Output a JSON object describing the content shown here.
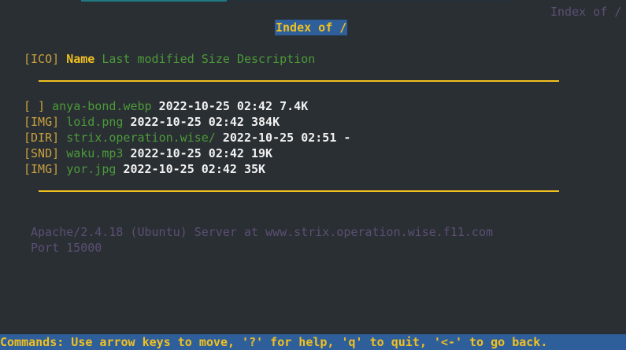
{
  "colors": {
    "background": "#2a2f33",
    "ico_tag": "#c8a040",
    "link": "#4c9a3a",
    "white": "#f2f2f2",
    "rule": "#f0c020",
    "dim": "#5b4f74",
    "title_bg": "#2f5f9a",
    "title_fg": "#f0c020",
    "status_bg": "#2f5f9a",
    "status_fg": "#f0c020",
    "accent_top": "#1f7a83"
  },
  "window": {
    "title_right": "Index of /"
  },
  "page": {
    "title": "Index of /"
  },
  "header": {
    "ico": "[ICO]",
    "name": "Name",
    "modified": "Last modified",
    "size": "Size",
    "description": "Description"
  },
  "entries": [
    {
      "tag": "[ ]",
      "name": "anya-bond.webp",
      "modified": "2022-10-25 02:42",
      "size": "7.4K"
    },
    {
      "tag": "[IMG]",
      "name": "loid.png",
      "modified": "2022-10-25 02:42",
      "size": "384K"
    },
    {
      "tag": "[DIR]",
      "name": "strix.operation.wise/",
      "modified": "2022-10-25 02:51",
      "size": "-"
    },
    {
      "tag": "[SND]",
      "name": "waku.mp3",
      "modified": "2022-10-25 02:42",
      "size": "19K"
    },
    {
      "tag": "[IMG]",
      "name": "yor.jpg",
      "modified": "2022-10-25 02:42",
      "size": "35K"
    }
  ],
  "server": {
    "line1": "Apache/2.4.18 (Ubuntu) Server at www.strix.operation.wise.f11.com",
    "line2": "Port 15000"
  },
  "status": {
    "commands": "Commands: Use arrow keys to move, '?' for help, 'q' to quit, '<-' to go back."
  }
}
